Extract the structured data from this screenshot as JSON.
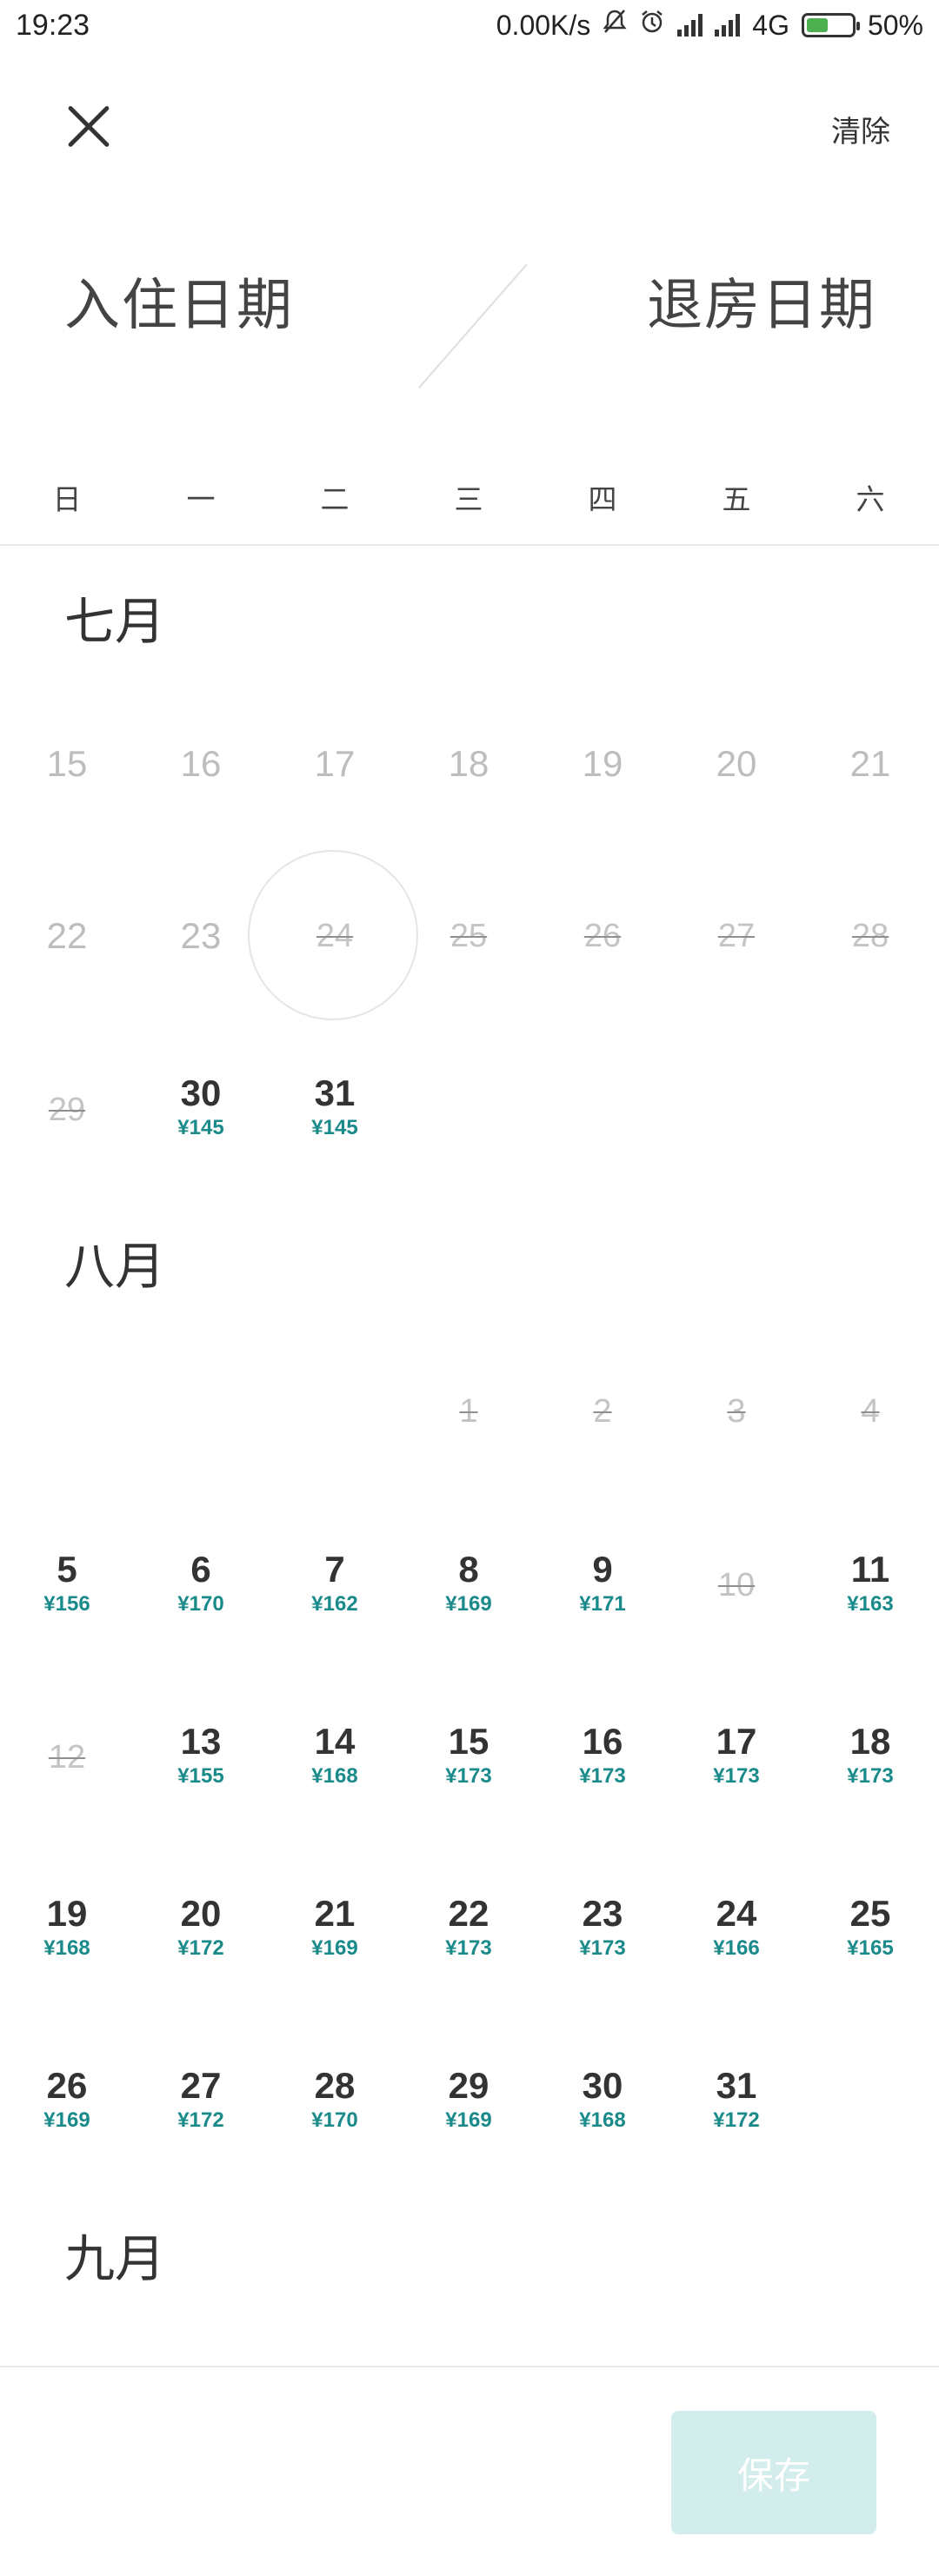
{
  "status_bar": {
    "time": "19:23",
    "net_speed": "0.00K/s",
    "network": "4G",
    "network_sub": "",
    "battery": "50%",
    "battery_level": 0.5
  },
  "header": {
    "clear_label": "清除"
  },
  "dates": {
    "checkin_label": "入住日期",
    "checkout_label": "退房日期"
  },
  "weekdays": [
    "日",
    "一",
    "二",
    "三",
    "四",
    "五",
    "六"
  ],
  "months": [
    {
      "title": "七月"
    },
    {
      "title": "八月"
    },
    {
      "title": "九月"
    }
  ],
  "july": {
    "past": [
      "15",
      "16",
      "17",
      "18",
      "19",
      "20",
      "21",
      "22",
      "23"
    ],
    "full": [
      "24",
      "25",
      "26",
      "27",
      "28",
      "29"
    ],
    "available": [
      {
        "day": "30",
        "price": "¥145"
      },
      {
        "day": "31",
        "price": "¥145"
      }
    ]
  },
  "august": {
    "full": [
      "1",
      "2",
      "3",
      "4",
      "10",
      "12"
    ],
    "available": [
      {
        "day": "5",
        "price": "¥156"
      },
      {
        "day": "6",
        "price": "¥170"
      },
      {
        "day": "7",
        "price": "¥162"
      },
      {
        "day": "8",
        "price": "¥169"
      },
      {
        "day": "9",
        "price": "¥171"
      },
      {
        "day": "11",
        "price": "¥163"
      },
      {
        "day": "13",
        "price": "¥155"
      },
      {
        "day": "14",
        "price": "¥168"
      },
      {
        "day": "15",
        "price": "¥173"
      },
      {
        "day": "16",
        "price": "¥173"
      },
      {
        "day": "17",
        "price": "¥173"
      },
      {
        "day": "18",
        "price": "¥173"
      },
      {
        "day": "19",
        "price": "¥168"
      },
      {
        "day": "20",
        "price": "¥172"
      },
      {
        "day": "21",
        "price": "¥169"
      },
      {
        "day": "22",
        "price": "¥173"
      },
      {
        "day": "23",
        "price": "¥173"
      },
      {
        "day": "24",
        "price": "¥166"
      },
      {
        "day": "25",
        "price": "¥165"
      },
      {
        "day": "26",
        "price": "¥169"
      },
      {
        "day": "27",
        "price": "¥172"
      },
      {
        "day": "28",
        "price": "¥170"
      },
      {
        "day": "29",
        "price": "¥169"
      },
      {
        "day": "30",
        "price": "¥168"
      },
      {
        "day": "31",
        "price": "¥172"
      }
    ]
  },
  "footer": {
    "save_label": "保存"
  },
  "colors": {
    "price": "#1a8a8a",
    "save_button_bg": "#d3ecec",
    "battery_fill": "#4caf50"
  }
}
